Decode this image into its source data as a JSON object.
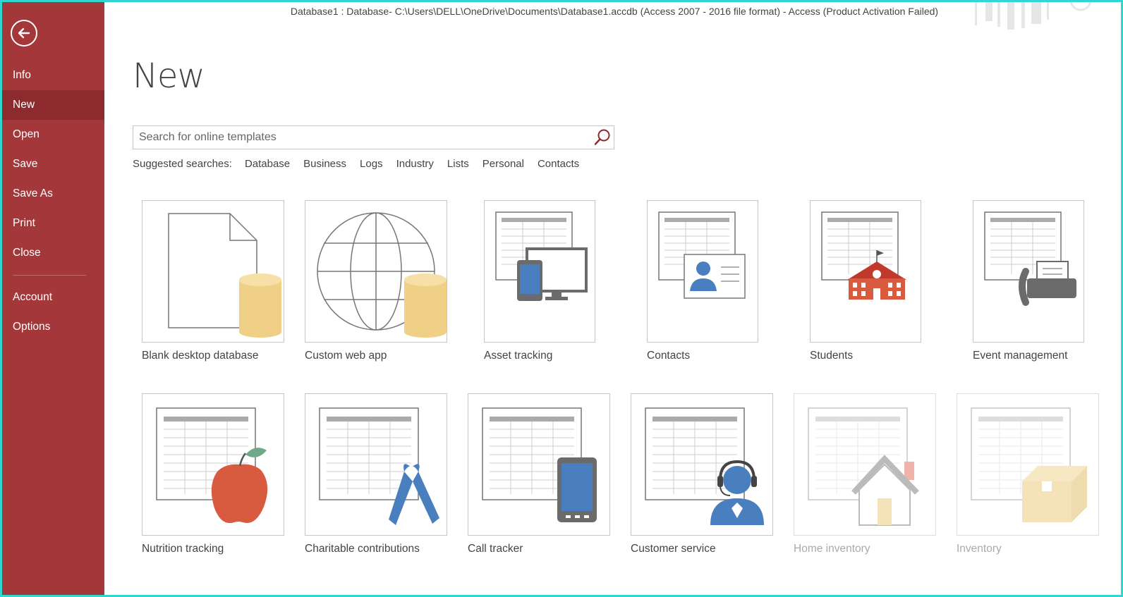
{
  "window": {
    "title": "Database1 : Database- C:\\Users\\DELL\\OneDrive\\Documents\\Database1.accdb (Access 2007 - 2016 file format) - Access (Product Activation Failed)"
  },
  "sidebar": {
    "back_icon": "back-arrow-icon",
    "items": [
      {
        "label": "Info"
      },
      {
        "label": "New",
        "active": true
      },
      {
        "label": "Open"
      },
      {
        "label": "Save"
      },
      {
        "label": "Save As"
      },
      {
        "label": "Print"
      },
      {
        "label": "Close"
      },
      {
        "label": "Account"
      },
      {
        "label": "Options"
      }
    ]
  },
  "main": {
    "title": "New",
    "search": {
      "placeholder": "Search for online templates",
      "value": ""
    },
    "suggested_label": "Suggested searches:",
    "suggested": [
      "Database",
      "Business",
      "Logs",
      "Industry",
      "Lists",
      "Personal",
      "Contacts"
    ],
    "templates": [
      {
        "label": "Blank desktop database",
        "icon": "blank-database-icon"
      },
      {
        "label": "Custom web app",
        "icon": "web-app-globe-icon"
      },
      {
        "label": "Asset tracking",
        "icon": "asset-tracking-icon"
      },
      {
        "label": "Contacts",
        "icon": "contact-card-icon"
      },
      {
        "label": "Students",
        "icon": "school-icon"
      },
      {
        "label": "Event management",
        "icon": "fax-icon"
      },
      {
        "label": "Nutrition tracking",
        "icon": "apple-icon"
      },
      {
        "label": "Charitable contributions",
        "icon": "ribbon-icon"
      },
      {
        "label": "Call tracker",
        "icon": "phone-icon"
      },
      {
        "label": "Customer service",
        "icon": "headset-icon"
      },
      {
        "label": "Home inventory",
        "icon": "house-icon"
      },
      {
        "label": "Inventory",
        "icon": "box-icon"
      }
    ]
  },
  "colors": {
    "sidebar": "#a4373a",
    "sidebar_active": "#8c2a2d",
    "accent_border": "#2ed7d0"
  }
}
